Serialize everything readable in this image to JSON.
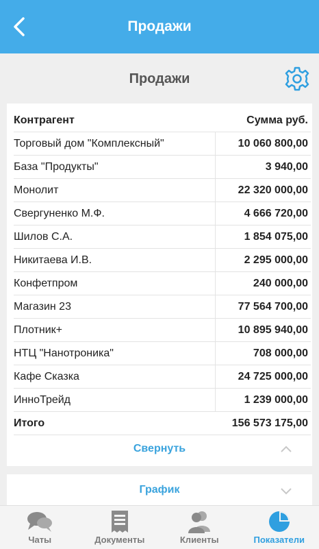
{
  "header": {
    "title": "Продажи"
  },
  "page": {
    "title": "Продажи"
  },
  "table": {
    "columns": [
      "Контрагент",
      "Сумма руб."
    ],
    "rows": [
      {
        "name": "Торговый дом \"Комплексный\"",
        "value": "10 060 800,00"
      },
      {
        "name": "База \"Продукты\"",
        "value": "3 940,00"
      },
      {
        "name": "Монолит",
        "value": "22 320 000,00"
      },
      {
        "name": "Свергуненко М.Ф.",
        "value": "4 666 720,00"
      },
      {
        "name": "Шилов С.А.",
        "value": "1 854 075,00"
      },
      {
        "name": "Никитаева И.В.",
        "value": "2 295 000,00"
      },
      {
        "name": "Конфетпром",
        "value": "240 000,00"
      },
      {
        "name": "Магазин 23",
        "value": "77 564 700,00"
      },
      {
        "name": "Плотник+",
        "value": "10 895 940,00"
      },
      {
        "name": "НТЦ \"Нанотроника\"",
        "value": "708 000,00"
      },
      {
        "name": "Кафе Сказка",
        "value": "24 725 000,00"
      },
      {
        "name": "ИнноТрейд",
        "value": "1 239 000,00"
      }
    ],
    "total": {
      "label": "Итого",
      "value": "156 573 175,00"
    }
  },
  "collapse_label": "Свернуть",
  "chart_label": "График",
  "tabs": [
    {
      "label": "Чаты",
      "icon": "chat-icon"
    },
    {
      "label": "Документы",
      "icon": "document-icon"
    },
    {
      "label": "Клиенты",
      "icon": "clients-icon"
    },
    {
      "label": "Показатели",
      "icon": "pie-chart-icon",
      "active": true
    }
  ],
  "colors": {
    "accent": "#44ace9",
    "link": "#3aa3dd",
    "background": "#efefef"
  }
}
